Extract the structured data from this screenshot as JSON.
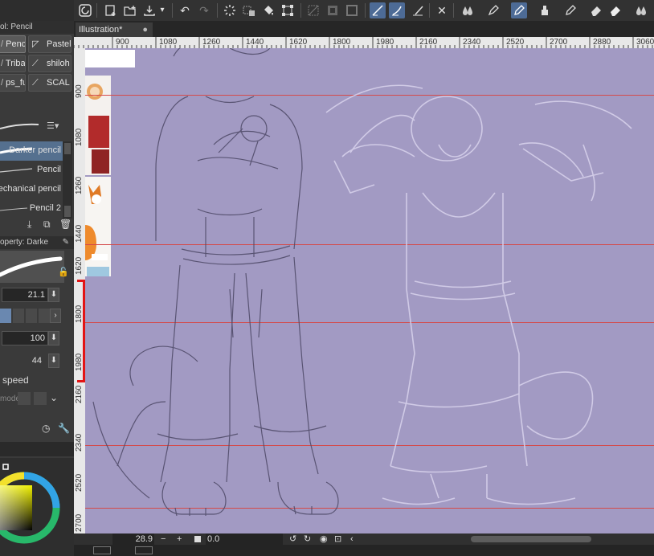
{
  "toolbar": {
    "icons": [
      "app-menu-icon",
      "new-file-icon",
      "open-file-icon",
      "save-icon",
      "undo-icon",
      "redo-icon",
      "loading-spinner-icon",
      "clear-icon",
      "fill-icon",
      "transform-icon",
      "deselect-icon",
      "invert-selection-icon",
      "selection-border-icon",
      "snap-ruler-icon",
      "snap-special-ruler-icon",
      "snap-grid-icon",
      "close-ruler-icon",
      "water-drop-icon",
      "pen-icon",
      "pencil-active-icon",
      "ink-bottle-icon",
      "marker-icon",
      "eraser-icon",
      "eraser-soft-icon",
      "blend-icon"
    ]
  },
  "left_panel": {
    "subtool_tab": "ol: Pencil",
    "subtools": [
      {
        "label": "Penci",
        "selected": true
      },
      {
        "label": "Pastel",
        "selected": false
      },
      {
        "label": "Tribal",
        "selected": false
      },
      {
        "label": "shiloh",
        "selected": false
      },
      {
        "label": "ps_fu",
        "selected": false
      },
      {
        "label": "SCAL",
        "selected": false
      }
    ],
    "brushes": [
      {
        "label": "Darker pencil",
        "selected": true
      },
      {
        "label": "Pencil",
        "selected": false
      },
      {
        "label": "echanical pencil",
        "selected": false
      },
      {
        "label": "Pencil 2",
        "selected": false
      }
    ],
    "property_tab": "operty: Darke",
    "brush_size": "21.1",
    "opacity": "100",
    "density": "44",
    "speed_label": "speed",
    "mode_label": "mode"
  },
  "canvas": {
    "tab_title": "Illustration*",
    "tab_close": "●",
    "ruler_h_labels": [
      "900",
      "1080",
      "1260",
      "1440",
      "1620",
      "1800",
      "1980",
      "2160",
      "2340",
      "2520",
      "2700",
      "2880",
      "3060"
    ],
    "ruler_v_labels": [
      "900",
      "1080",
      "1260",
      "1440",
      "1620",
      "1800",
      "1980",
      "2160",
      "2340",
      "2520",
      "2700"
    ],
    "background_color": "#a29ac3"
  },
  "bottom_bar": {
    "zoom": "28.9",
    "minus": "−",
    "plus": "+",
    "angle": "0.0"
  },
  "colors": {
    "guide_red": "#d44a4a",
    "select_blue": "#55708f",
    "accent_red": "#e31414"
  }
}
